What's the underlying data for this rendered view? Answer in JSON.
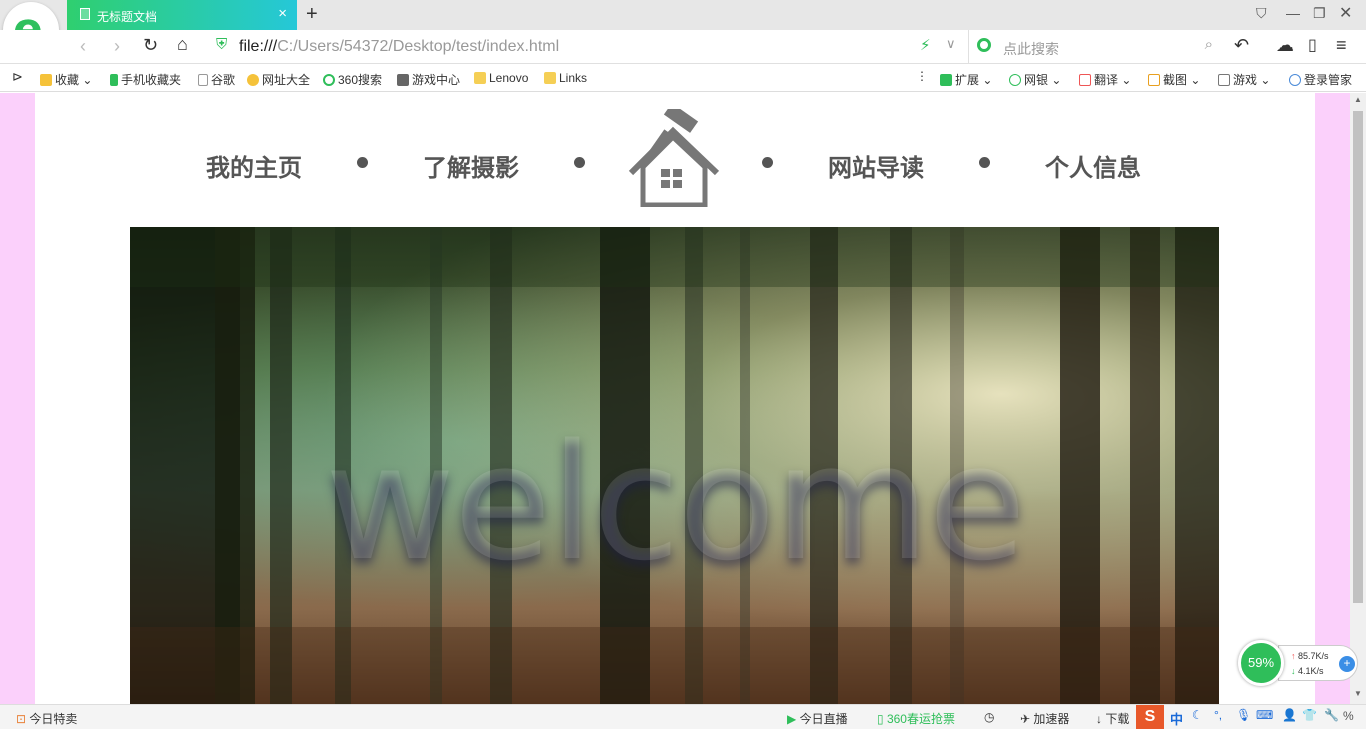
{
  "browser": {
    "tab_title": "无标题文档",
    "url_scheme": "file:///",
    "url_path": "C:/Users/54372/Desktop/test/index.html",
    "search_placeholder": "点此搜索"
  },
  "bookmarks": {
    "items": [
      "收藏",
      "手机收藏夹",
      "谷歌",
      "网址大全",
      "360搜索",
      "游戏中心",
      "Lenovo",
      "Links"
    ],
    "right_items": [
      "扩展",
      "网银",
      "翻译",
      "截图",
      "游戏",
      "登录管家"
    ]
  },
  "site": {
    "nav": [
      "我的主页",
      "了解摄影",
      "网站导读",
      "个人信息"
    ],
    "hero_text": "welcome",
    "page_bg": "#fbd0fb"
  },
  "status": {
    "left": "今日特卖",
    "items": [
      "今日直播",
      "360春运抢票",
      "加速器",
      "下载"
    ],
    "ime": "中"
  },
  "netmon": {
    "percent": "59%",
    "up": "85.7K/s",
    "down": "4.1K/s"
  }
}
